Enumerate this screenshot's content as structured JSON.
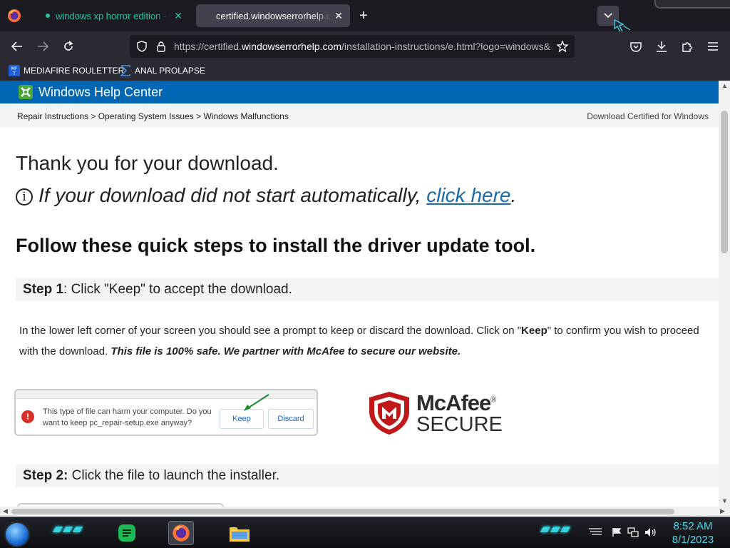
{
  "browser": {
    "tabs": [
      {
        "title": "windows xp horror edition - Go",
        "close": "✕"
      },
      {
        "title": "certified.windowserrorhelp.com",
        "close": "✕"
      }
    ],
    "new_tab": "+",
    "url": {
      "prefix": "https://certified.",
      "domain": "windowserrorhelp.com",
      "path": "/installation-instructions/e.html?logo=windows&"
    },
    "bookmarks": [
      {
        "label": "MEDIAFIRE ROULETTER",
        "icon": "mediafire-icon"
      },
      {
        "label": "ANAL PROLAPSE",
        "icon": "sigma-icon"
      }
    ]
  },
  "page": {
    "site_title": "Windows Help Center",
    "breadcrumb": "Repair Instructions > Operating System Issues > Windows Malfunctions",
    "download_link": "Download Certified for Windows",
    "thanks": "Thank you for your download.",
    "info_glyph": "i",
    "auto_text": "If your download did not start automatically, ",
    "click_here": "click here",
    "auto_end": ".",
    "follow": "Follow these quick steps to install the driver update tool.",
    "step1_label": "Step 1",
    "step1_text": ":  Click \"Keep\" to accept the download.",
    "para_a": "In the lower left corner of your screen you should see a prompt to keep or discard the download. Click on \"",
    "para_keep": "Keep",
    "para_b": "\" to confirm you wish to proceed with the download. ",
    "para_safe": "This file is 100% safe. We partner with McAfee to secure our website.",
    "prompt": {
      "warning_glyph": "!",
      "message": "This type of file can harm your computer. Do you want to keep pc_repair-setup.exe anyway?",
      "keep": "Keep",
      "discard": "Discard"
    },
    "mcafee": {
      "name": "McAfee",
      "registered": "®",
      "secure": "SECURE"
    },
    "step2_label": "Step 2:",
    "step2_text": "  Click the file to launch the installer."
  },
  "taskbar": {
    "time": "8:52 AM",
    "date": "8/1/2023",
    "accent": "#35d3e0"
  },
  "colors": {
    "header_blue": "#0066b3",
    "link": "#1a6aa9",
    "firefox_teal": "#2ac3a2"
  }
}
